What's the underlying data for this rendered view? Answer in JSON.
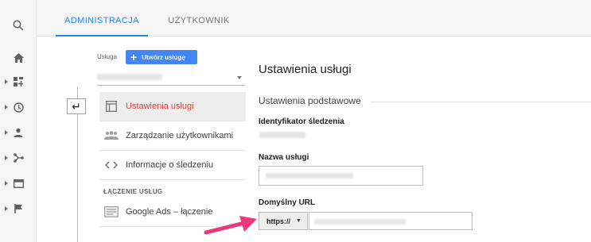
{
  "tabs": {
    "admin": "ADMINISTRACJA",
    "user": "UŻYTKOWNIK"
  },
  "rail_icons": [
    "search-icon",
    "home-icon",
    "dashboard-icon",
    "clock-icon",
    "person-icon",
    "share-icon",
    "table-icon",
    "flag-icon"
  ],
  "middle": {
    "service_label": "Usługa",
    "create_button": "Utwórz usługę",
    "menu": [
      {
        "label": "Ustawienia usługi",
        "icon": "layout-icon",
        "active": true
      },
      {
        "label": "Zarządzanie użytkownikami",
        "icon": "users-icon",
        "active": false
      },
      {
        "label": "Informacje o śledzeniu",
        "icon": "code-icon",
        "active": false
      }
    ],
    "section_linking": "ŁĄCZENIE USŁUG",
    "linking_items": [
      {
        "label": "Google Ads – łączenie",
        "icon": "ads-icon"
      }
    ]
  },
  "right": {
    "title": "Ustawienia usługi",
    "section": "Ustawienia podstawowe",
    "tracking_id_label": "Identyfikator śledzenia",
    "service_name_label": "Nazwa usługi",
    "default_url_label": "Domyślny URL",
    "protocol_value": "https://"
  },
  "colors": {
    "accent": "#1e88e5",
    "active_menu_text": "#e53935",
    "button": "#4285f4",
    "arrow": "#f0367a"
  }
}
